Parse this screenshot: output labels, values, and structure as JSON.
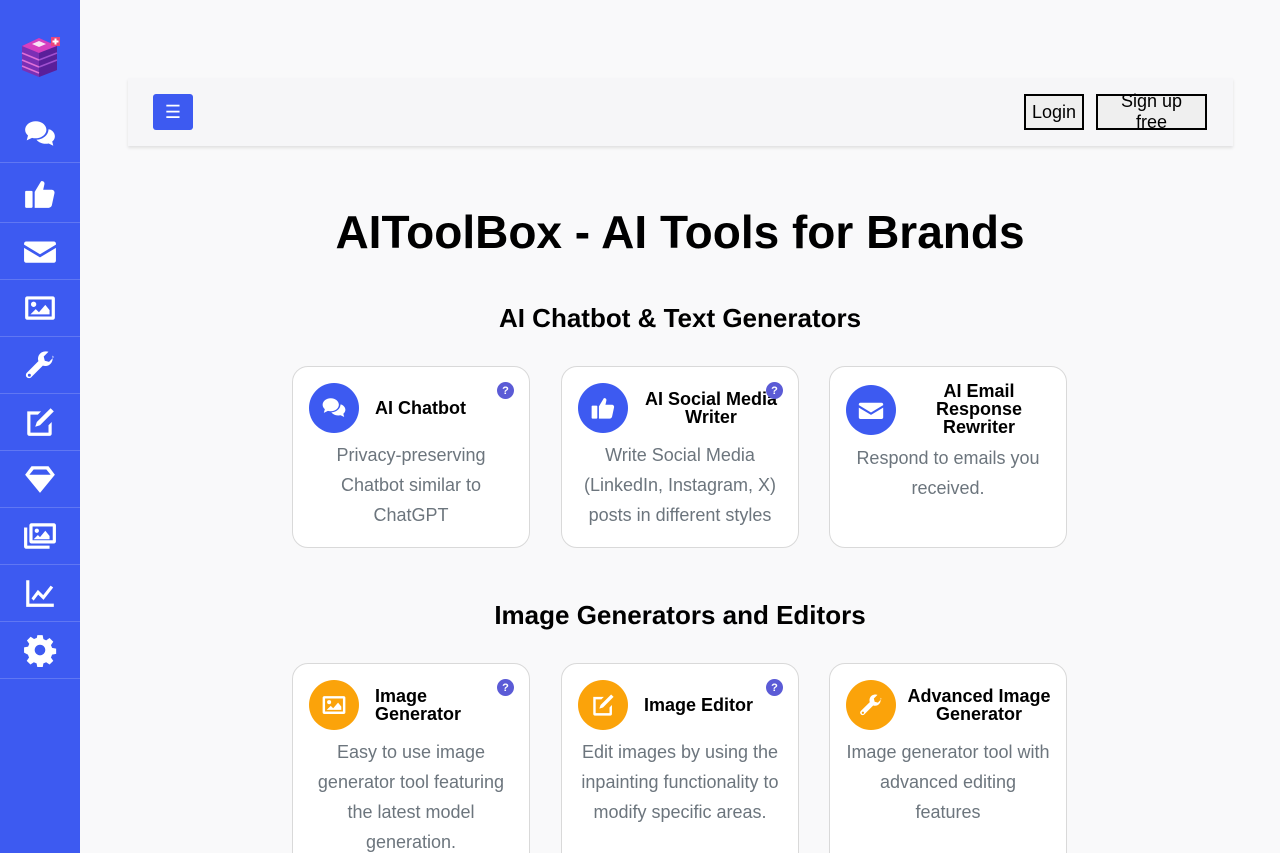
{
  "header": {
    "menu_icon": "☰",
    "login_label": "Login",
    "signup_label": "Sign up free"
  },
  "sidebar": {
    "logo": "cube-logo",
    "items": [
      {
        "icon": "chat-icon"
      },
      {
        "icon": "thumbs-up-icon"
      },
      {
        "icon": "envelope-icon"
      },
      {
        "icon": "image-icon"
      },
      {
        "icon": "wrench-icon"
      },
      {
        "icon": "edit-icon"
      },
      {
        "icon": "gem-icon"
      },
      {
        "icon": "images-icon"
      },
      {
        "icon": "chart-line-icon"
      },
      {
        "icon": "gear-icon"
      }
    ]
  },
  "main": {
    "title": "AIToolBox - AI Tools for Brands",
    "sections": [
      {
        "title": "AI Chatbot & Text Generators",
        "cards": [
          {
            "title": "AI Chatbot",
            "description": "Privacy-preserving Chatbot similar to ChatGPT",
            "icon": "chat-icon",
            "help": "?"
          },
          {
            "title": "AI Social Media Writer",
            "description": "Write Social Media (LinkedIn, Instagram, X) posts in different styles",
            "icon": "thumbs-up-icon",
            "help": "?"
          },
          {
            "title": "AI Email Response Rewriter",
            "description": "Respond to emails you received.",
            "icon": "envelope-icon"
          }
        ]
      },
      {
        "title": "Image Generators and Editors",
        "cards": [
          {
            "title": "Image Generator",
            "description": "Easy to use image generator tool featuring the latest model generation.",
            "icon": "image-icon",
            "help": "?"
          },
          {
            "title": "Image Editor",
            "description": "Edit images by using the inpainting functionality to modify specific areas.",
            "icon": "edit-icon",
            "help": "?"
          },
          {
            "title": "Advanced Image Generator",
            "description": "Image generator tool with advanced editing features",
            "icon": "wrench-icon"
          }
        ]
      }
    ]
  },
  "colors": {
    "primary": "#3d5af1",
    "accent": "#fba30a",
    "help_badge": "#5b5bd6"
  }
}
